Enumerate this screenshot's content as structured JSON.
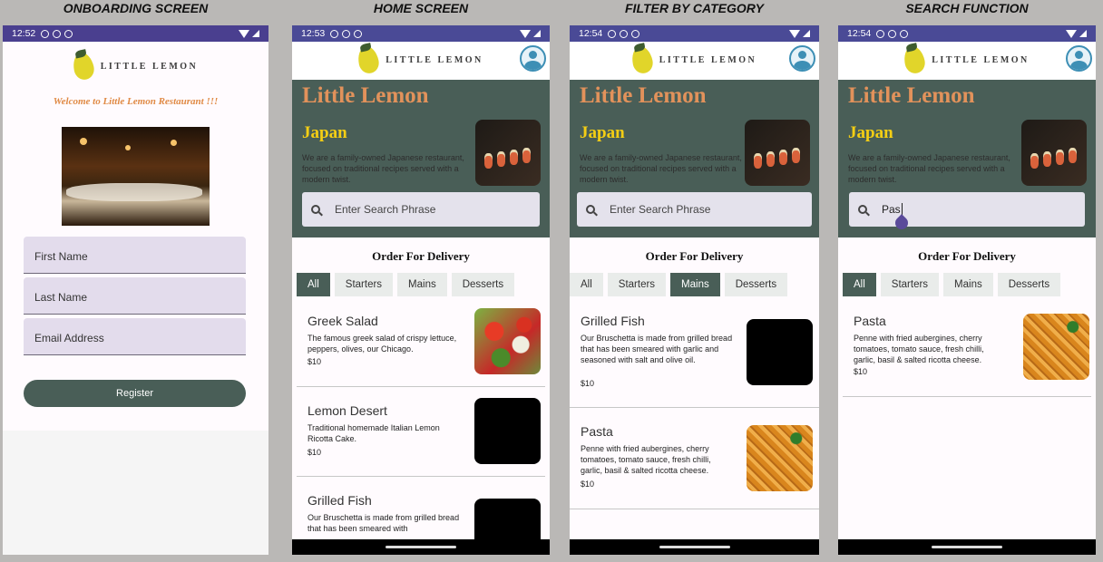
{
  "titles": [
    "ONBOARDING SCREEN",
    "HOME SCREEN",
    "FILTER BY CATEGORY",
    "SEARCH FUNCTION"
  ],
  "colors": {
    "primary": "#495e57",
    "yellow": "#f4ce14",
    "orange": "#e2925b",
    "statusbar": "#4a3f8f"
  },
  "brand": {
    "logo_text": "LITTLE LEMON",
    "logo_icon": "lemon-icon"
  },
  "onboarding": {
    "time": "12:52",
    "welcome": "Welcome to Little Lemon Restaurant !!!",
    "fields": [
      "First Name",
      "Last Name",
      "Email Address"
    ],
    "register_label": "Register"
  },
  "hero": {
    "title": "Little Lemon",
    "subtitle": "Japan",
    "description": "We are a family-owned Japanese restaurant, focused on traditional recipes served with a modern twist.",
    "search_placeholder": "Enter Search Phrase"
  },
  "order_title": "Order For Delivery",
  "categories": [
    "All",
    "Starters",
    "Mains",
    "Desserts"
  ],
  "home": {
    "time": "12:53",
    "items": [
      {
        "name": "Greek Salad",
        "desc": "The famous greek salad of crispy lettuce, peppers, olives, our Chicago.",
        "price": "$10"
      },
      {
        "name": "Lemon Desert",
        "desc": "Traditional homemade Italian Lemon Ricotta Cake.",
        "price": "$10"
      },
      {
        "name": "Grilled Fish",
        "desc": "Our Bruschetta is made from grilled bread that has been smeared with",
        "price": ""
      }
    ]
  },
  "filter": {
    "time": "12:54",
    "active_category": "Mains",
    "items": [
      {
        "name": "Grilled Fish",
        "desc": "Our Bruschetta is made from grilled bread that has been smeared with garlic and seasoned with salt and olive oil.",
        "price": "$10"
      },
      {
        "name": "Pasta",
        "desc": "Penne with fried aubergines, cherry tomatoes, tomato sauce, fresh chilli, garlic, basil & salted ricotta cheese.",
        "price": "$10"
      }
    ]
  },
  "search": {
    "time": "12:54",
    "query": "Pas",
    "items": [
      {
        "name": "Pasta",
        "desc": "Penne with fried aubergines, cherry tomatoes, tomato sauce, fresh chilli, garlic, basil & salted ricotta cheese.",
        "price": "$10"
      }
    ]
  }
}
